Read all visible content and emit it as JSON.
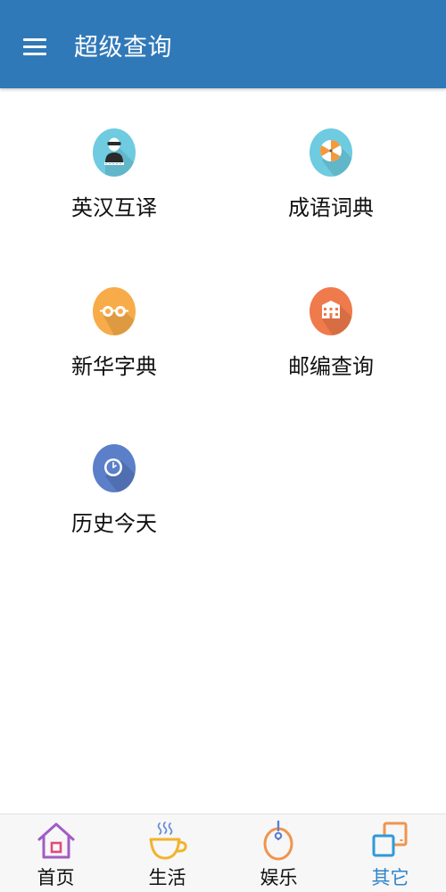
{
  "app": {
    "title": "超级查询",
    "header_color": "#3079b8"
  },
  "menu": {
    "icon": "hamburger-menu-icon"
  },
  "grid": {
    "items": [
      {
        "label": "英汉互译",
        "icon": "translator-person-icon",
        "color": "#6ecbe0"
      },
      {
        "label": "成语词典",
        "icon": "beach-umbrella-icon",
        "color": "#6ecbe0"
      },
      {
        "label": "新华字典",
        "icon": "glasses-icon",
        "color": "#f7ac49"
      },
      {
        "label": "邮编查询",
        "icon": "post-office-building-icon",
        "color": "#ef7a4b"
      },
      {
        "label": "历史今天",
        "icon": "clock-icon",
        "color": "#5b7fc9"
      }
    ]
  },
  "bottom_nav": {
    "tabs": [
      {
        "label": "首页",
        "icon": "home-icon",
        "color": "#a05dc4",
        "active": false
      },
      {
        "label": "生活",
        "icon": "coffee-cup-icon",
        "color": "#f2b32c",
        "active": false
      },
      {
        "label": "娱乐",
        "icon": "mouse-icon",
        "color": "#f1944d",
        "active": false
      },
      {
        "label": "其它",
        "icon": "overlapping-squares-icon",
        "color": "#2f84cc",
        "active": true
      }
    ],
    "active_label_color": "#2f84cc"
  }
}
